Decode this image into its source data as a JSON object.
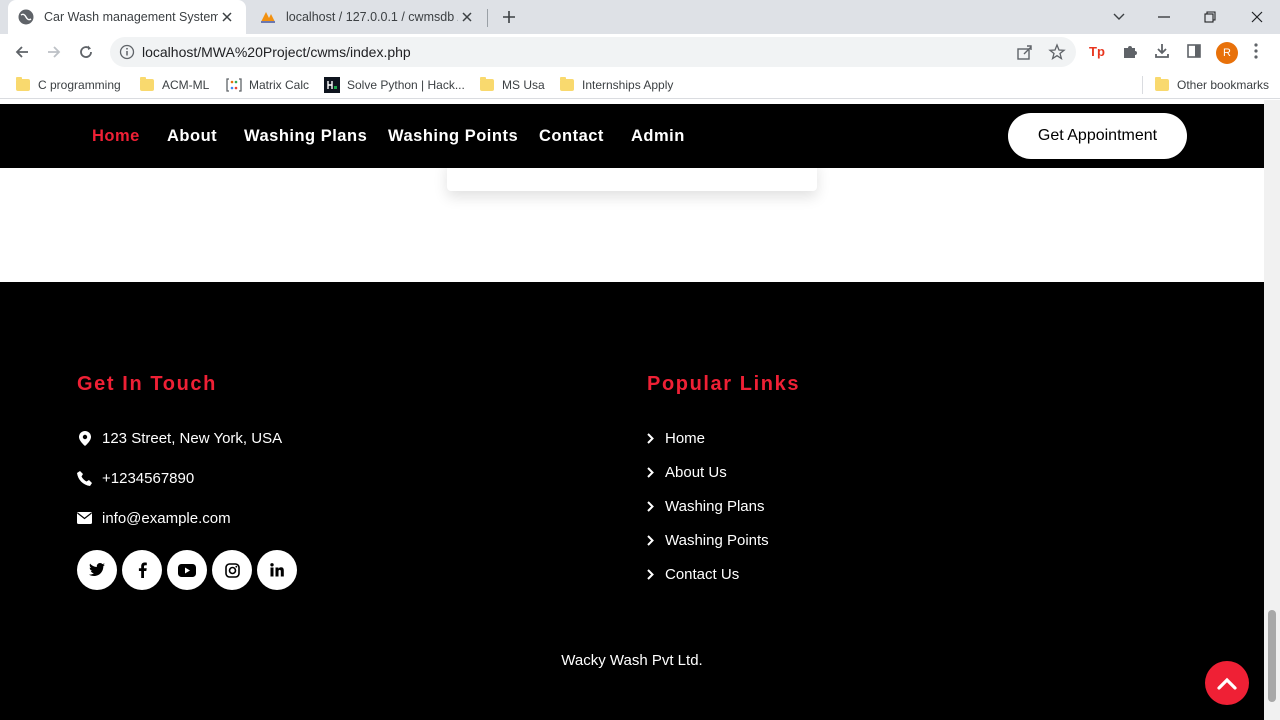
{
  "browser": {
    "tabs": [
      {
        "title": "Car Wash management System |",
        "active": true
      },
      {
        "title": "localhost / 127.0.0.1 / cwmsdb / t",
        "active": false
      }
    ],
    "url": "localhost/MWA%20Project/cwms/index.php",
    "profile_initial": "R",
    "bookmarks": [
      {
        "label": "C programming",
        "icon": "folder-icon"
      },
      {
        "label": "ACM-ML",
        "icon": "folder-icon"
      },
      {
        "label": "Matrix Calc",
        "icon": "matrix-calc-icon"
      },
      {
        "label": "Solve Python | Hack...",
        "icon": "hackerrank-icon"
      },
      {
        "label": "MS Usa",
        "icon": "folder-icon"
      },
      {
        "label": "Internships Apply",
        "icon": "folder-icon"
      }
    ],
    "other_bookmarks": "Other bookmarks"
  },
  "navbar": {
    "links": [
      "Home",
      "About",
      "Washing Plans",
      "Washing Points",
      "Contact",
      "Admin"
    ],
    "active": "Home",
    "cta": "Get Appointment"
  },
  "footer": {
    "contact_heading": "Get In Touch",
    "address": "123 Street, New York, USA",
    "phone": "+1234567890",
    "email": "info@example.com",
    "social": [
      "twitter-icon",
      "facebook-icon",
      "youtube-icon",
      "instagram-icon",
      "linkedin-icon"
    ],
    "links_heading": "Popular Links",
    "links": [
      "Home",
      "About Us",
      "Washing Plans",
      "Washing Points",
      "Contact Us"
    ],
    "copyright": "Wacky Wash Pvt Ltd."
  },
  "colors": {
    "accent": "#ef2035",
    "nav_bg": "#000000",
    "footer_bg": "#000000"
  }
}
